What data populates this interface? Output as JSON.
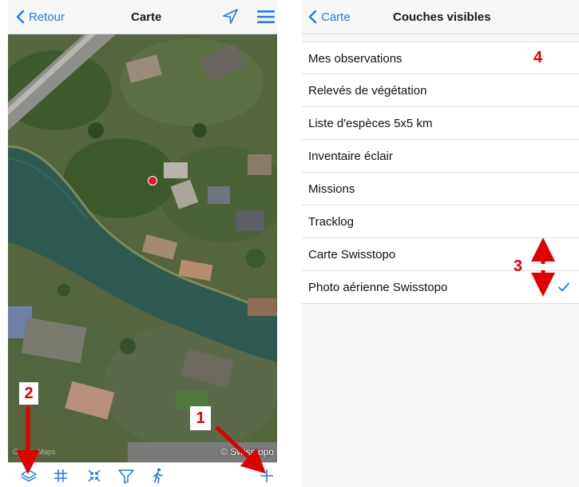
{
  "left_screen": {
    "nav": {
      "back_label": "Retour",
      "title": "Carte",
      "icons": [
        "location-arrow-icon",
        "hamburger-menu-icon"
      ]
    },
    "map": {
      "copyright": "© Swisstopo",
      "watermark": "Google Maps",
      "pin_color": "#e11b22"
    },
    "toolbar": {
      "icons": [
        "layers-icon",
        "grid-icon",
        "collapse-icon",
        "filter-icon",
        "walker-icon",
        "plus-icon"
      ]
    }
  },
  "right_screen": {
    "nav": {
      "back_label": "Carte",
      "title": "Couches visibles"
    },
    "layers": [
      {
        "label": "Mes observations",
        "checked": false
      },
      {
        "label": "Relevés de végétation",
        "checked": false
      },
      {
        "label": "Liste d'espèces 5x5 km",
        "checked": false
      },
      {
        "label": "Inventaire éclair",
        "checked": false
      },
      {
        "label": "Missions",
        "checked": false
      },
      {
        "label": "Tracklog",
        "checked": false
      },
      {
        "label": "Carte Swisstopo",
        "checked": false
      },
      {
        "label": "Photo aérienne Swisstopo",
        "checked": true
      }
    ]
  },
  "annotations": {
    "one": "1",
    "two": "2",
    "three": "3",
    "four": "4"
  },
  "colors": {
    "accent": "#1e7bf2",
    "annotation": "#e00000"
  }
}
